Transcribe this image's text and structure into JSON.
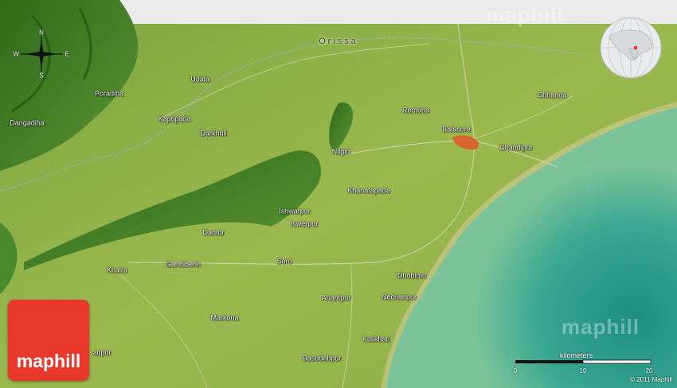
{
  "map": {
    "region_label": "Orissa",
    "places": [
      {
        "name": "Udala"
      },
      {
        "name": "Poradiha"
      },
      {
        "name": "Dangadiha"
      },
      {
        "name": "Kaptipada"
      },
      {
        "name": "Darkhuli"
      },
      {
        "name": "Remuna"
      },
      {
        "name": "Chhanua"
      },
      {
        "name": "Balasore"
      },
      {
        "name": "Chandipur"
      },
      {
        "name": "Nilgiri"
      },
      {
        "name": "Khanatapada"
      },
      {
        "name": "Ishwarpur"
      },
      {
        "name": "Iswerpur"
      },
      {
        "name": "Dantur"
      },
      {
        "name": "Khaira"
      },
      {
        "name": "Gandiberih"
      },
      {
        "name": "Soro"
      },
      {
        "name": "Dhobimu"
      },
      {
        "name": "Anantpur"
      },
      {
        "name": "Nechanpur"
      },
      {
        "name": "Markona"
      },
      {
        "name": "Kulikhati"
      },
      {
        "name": "aupur"
      },
      {
        "name": "Basudebpur"
      }
    ],
    "compass": {
      "n": "N",
      "s": "S",
      "e": "E",
      "w": "W"
    },
    "watermarks": [
      "maphill",
      "maphill"
    ]
  },
  "logo": {
    "text": "maphill",
    "color": "#e8392c"
  },
  "scale": {
    "title": "kilometers",
    "ticks": [
      "0",
      "10",
      "20"
    ]
  },
  "copyright": "© 2011 Maphill",
  "colors": {
    "land": "#8fb04a",
    "sea": "#3fa88a",
    "hills": "#3f7a22",
    "city": "#e05a2a",
    "roads": "#c9c9a8",
    "border": "#9aa8c8"
  }
}
